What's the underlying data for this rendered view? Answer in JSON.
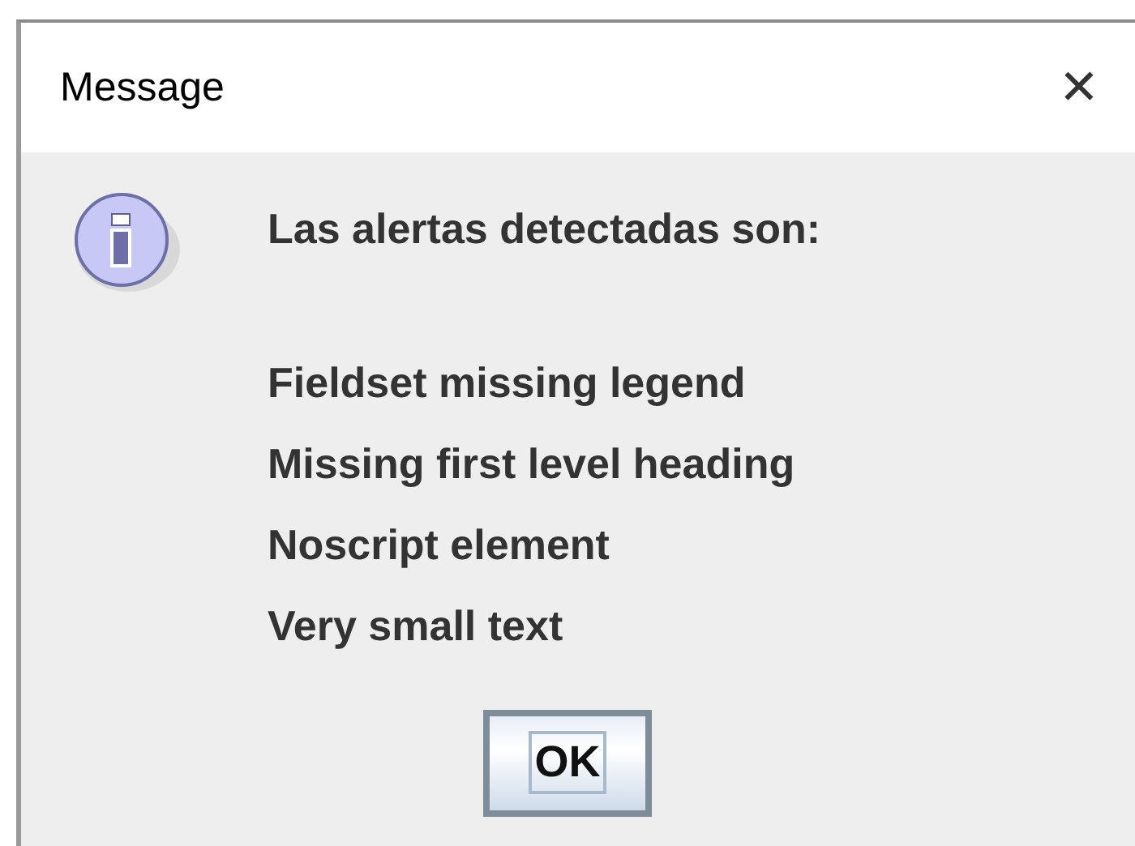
{
  "window": {
    "title": "Message",
    "close": "✕"
  },
  "message": {
    "heading": "Las alertas detectadas son:",
    "alerts": [
      "Fieldset missing legend",
      "Missing first level heading",
      "Noscript element",
      "Very small text"
    ]
  },
  "buttons": [
    {
      "label": "OK",
      "focused": true
    }
  ]
}
